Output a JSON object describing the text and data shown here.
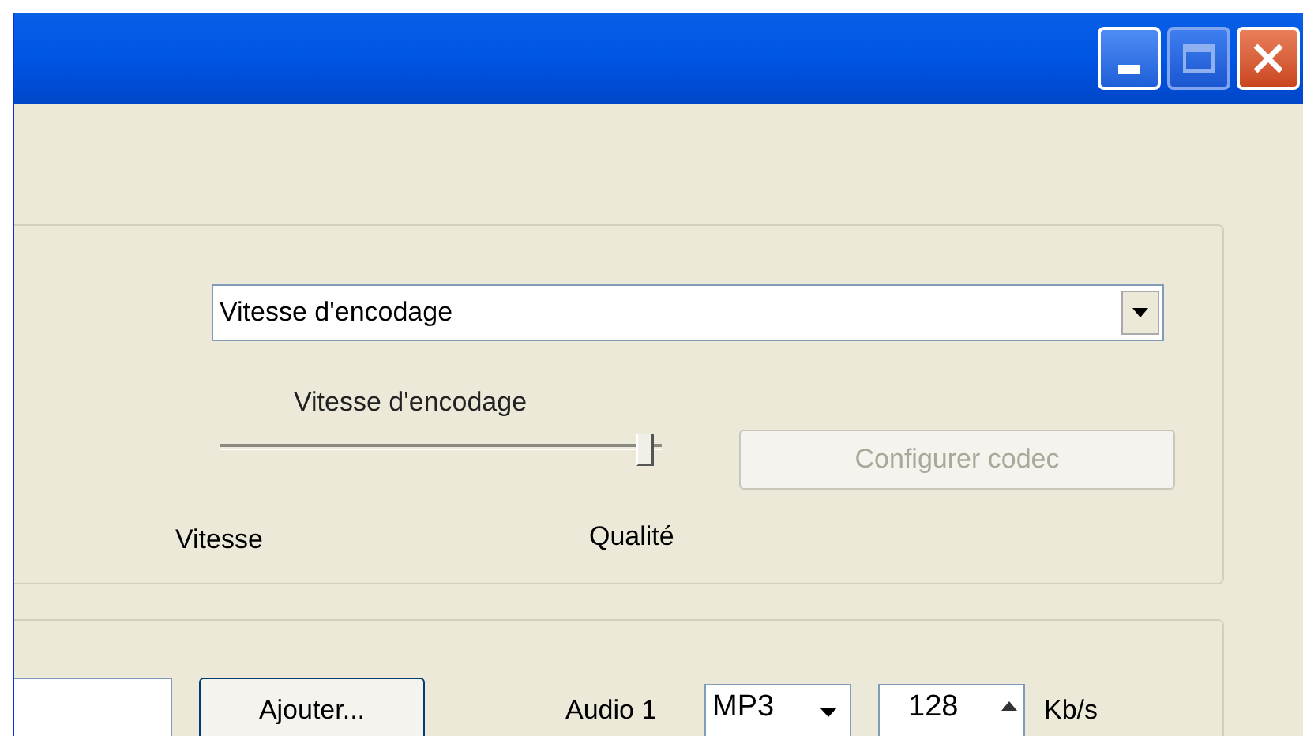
{
  "encoding_group": {
    "mode_select": {
      "value": "Vitesse d'encodage"
    },
    "slider": {
      "label": "Vitesse d'encodage",
      "level": 0.98,
      "min_label": "Vitesse",
      "max_label": "Qualité"
    },
    "codec_button": {
      "label": "Configurer codec",
      "disabled": true
    }
  },
  "tracks_group": {
    "add_button": "Ajouter...",
    "audio_label": "Audio 1",
    "codec_select": "MP3",
    "bitrate": "128",
    "bitrate_unit": "Kb/s"
  }
}
